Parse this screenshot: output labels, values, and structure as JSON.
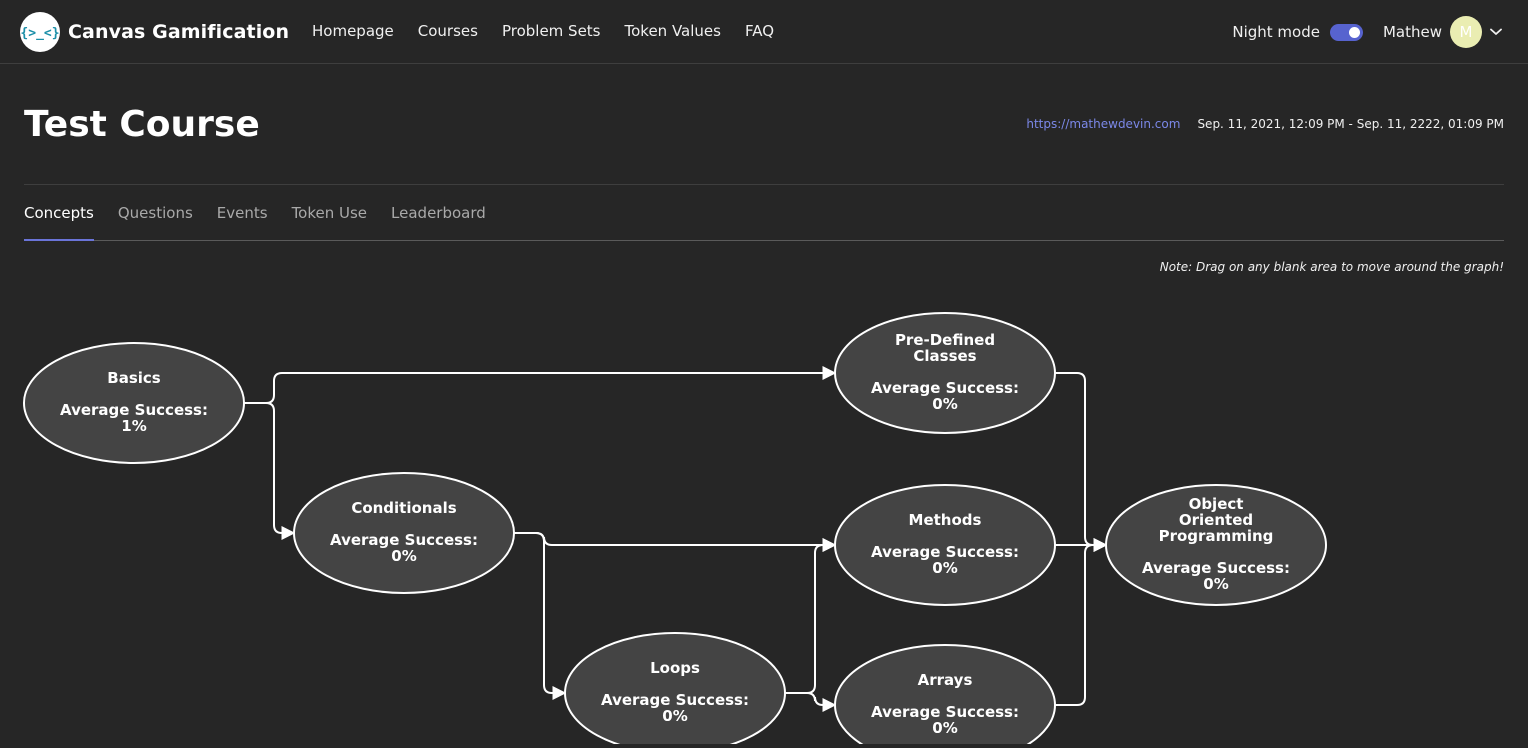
{
  "brand": {
    "name": "Canvas Gamification",
    "logo_text": "{>_<}"
  },
  "nav": {
    "links": [
      "Homepage",
      "Courses",
      "Problem Sets",
      "Token Values",
      "FAQ"
    ],
    "night_mode_label": "Night mode",
    "night_mode_on": true,
    "user_name": "Mathew",
    "avatar_initial": "M"
  },
  "course": {
    "title": "Test Course",
    "url": "https://mathewdevin.com",
    "dates": "Sep. 11, 2021, 12:09 PM - Sep. 11, 2222, 01:09 PM"
  },
  "tabs": [
    "Concepts",
    "Questions",
    "Events",
    "Token Use",
    "Leaderboard"
  ],
  "active_tab": "Concepts",
  "note": "Note: Drag on any blank area to move around the graph!",
  "colors": {
    "accent": "#5763cf",
    "link": "#7b88e8",
    "node_fill": "#444444",
    "node_stroke": "#ffffff",
    "avatar": "#eaedb2"
  },
  "graph": {
    "success_label": "Average Success:",
    "nodes": [
      {
        "id": "basics",
        "title_lines": [
          "Basics"
        ],
        "success": "1%"
      },
      {
        "id": "conditionals",
        "title_lines": [
          "Conditionals"
        ],
        "success": "0%"
      },
      {
        "id": "loops",
        "title_lines": [
          "Loops"
        ],
        "success": "0%"
      },
      {
        "id": "predefined-classes",
        "title_lines": [
          "Pre-Defined",
          "Classes"
        ],
        "success": "0%"
      },
      {
        "id": "methods",
        "title_lines": [
          "Methods"
        ],
        "success": "0%"
      },
      {
        "id": "arrays",
        "title_lines": [
          "Arrays"
        ],
        "success": "0%"
      },
      {
        "id": "oop",
        "title_lines": [
          "Object",
          "Oriented",
          "Programming"
        ],
        "success": "0%"
      }
    ],
    "edges": [
      [
        "basics",
        "conditionals"
      ],
      [
        "basics",
        "predefined-classes"
      ],
      [
        "conditionals",
        "loops"
      ],
      [
        "conditionals",
        "methods"
      ],
      [
        "loops",
        "methods"
      ],
      [
        "loops",
        "arrays"
      ],
      [
        "predefined-classes",
        "oop"
      ],
      [
        "methods",
        "oop"
      ],
      [
        "arrays",
        "oop"
      ]
    ]
  }
}
